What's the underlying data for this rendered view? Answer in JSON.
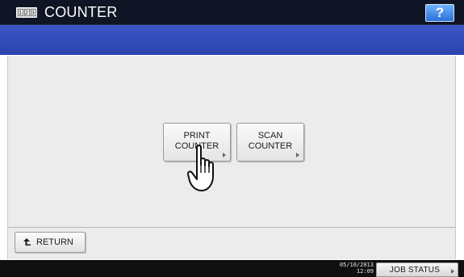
{
  "window": {
    "title": "COUNTER",
    "title_icon_digits": [
      "1",
      "2",
      "3"
    ],
    "help_label": "?"
  },
  "main": {
    "buttons": [
      {
        "label": "PRINT\nCOUNTER"
      },
      {
        "label": "SCAN\nCOUNTER"
      }
    ],
    "return_label": "RETURN"
  },
  "status_bar": {
    "date": "05/10/2013",
    "time": "12:09",
    "job_status_label": "JOB STATUS"
  },
  "icons": {
    "title_icon": "counter-123-icon",
    "return_icon": "return-arrow-icon",
    "pointer": "hand-pointer-icon"
  },
  "colors": {
    "title_bar": "#0f1525",
    "blue_band": "#2c43ad",
    "help_button": "#2b6fd8",
    "panel": "#ececec",
    "status_bar": "#101010"
  }
}
